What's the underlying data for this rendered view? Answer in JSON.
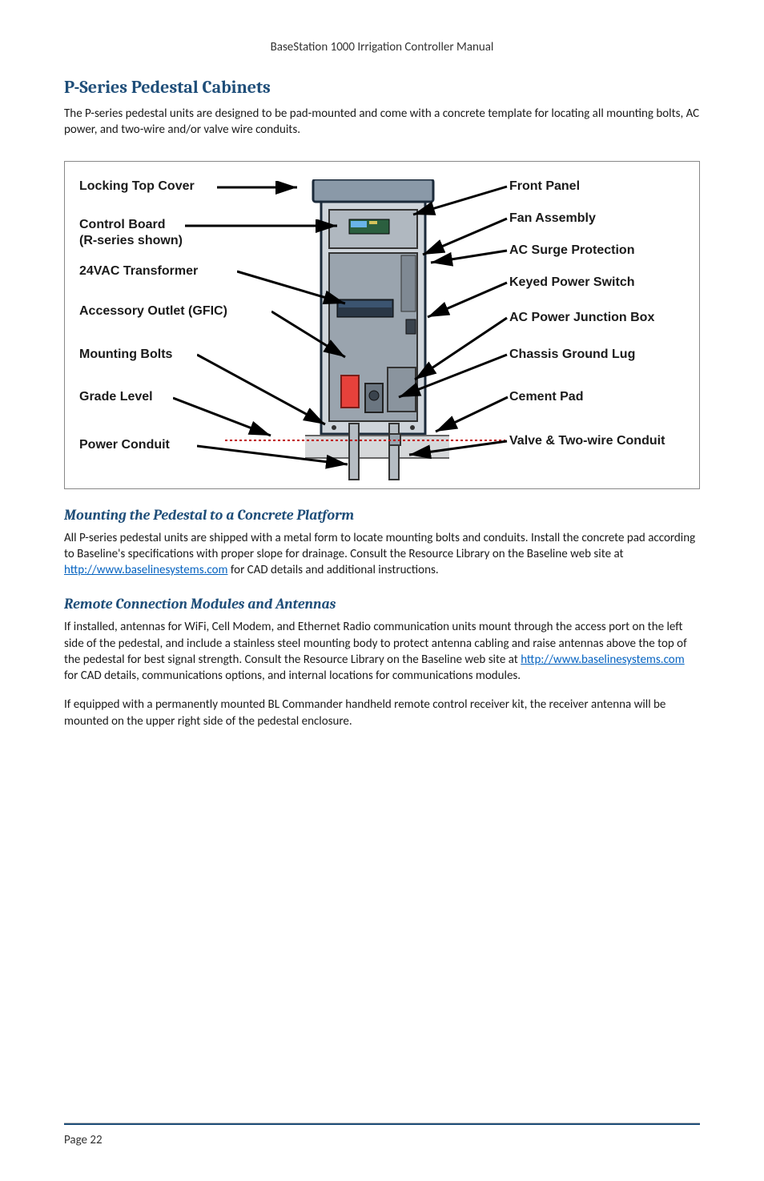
{
  "header": "BaseStation 1000 Irrigation Controller Manual",
  "section_title": "P-Series Pedestal Cabinets",
  "intro": "The P-series pedestal units are designed to be pad-mounted and come with a concrete template for locating all mounting bolts, AC power, and two-wire and/or valve wire conduits.",
  "diagram": {
    "left": {
      "locking_top": "Locking Top Cover",
      "control_board_l1": "Control Board",
      "control_board_l2": "(R-series shown)",
      "transformer": "24VAC Transformer",
      "outlet": "Accessory Outlet (GFIC)",
      "bolts": "Mounting Bolts",
      "grade": "Grade Level",
      "conduit": "Power Conduit"
    },
    "right": {
      "front_panel": "Front Panel",
      "fan": "Fan Assembly",
      "surge": "AC Surge Protection",
      "keyed": "Keyed Power Switch",
      "junction": "AC Power Junction Box",
      "ground": "Chassis Ground Lug",
      "cement": "Cement Pad",
      "valve_conduit": "Valve & Two-wire Conduit"
    }
  },
  "sub1_title": "Mounting the Pedestal to a Concrete Platform",
  "sub1_body_a": "All P-series pedestal units are shipped with a metal form to locate mounting bolts and conduits. Install the concrete pad according to Baseline's specifications with proper slope for drainage. Consult the Resource Library on the Baseline web site at ",
  "sub1_link": "http://www.baselinesystems.com",
  "sub1_body_b": " for CAD details and additional instructions.",
  "sub2_title": "Remote Connection Modules and Antennas",
  "sub2_p1_a": "If installed, antennas for WiFi, Cell Modem, and Ethernet Radio communication units mount through the access port on the left side of the pedestal, and include a stainless steel mounting body to protect antenna cabling and raise antennas above the top of the pedestal for best signal strength. Consult the Resource Library on the Baseline web site at ",
  "sub2_link": "http://www.baselinesystems.com",
  "sub2_p1_b": " for CAD details, communications options, and internal locations for communications modules.",
  "sub2_p2": "If equipped with a permanently mounted BL Commander handheld remote control receiver kit, the receiver antenna will be mounted on the upper right side of the pedestal enclosure.",
  "page": "Page 22"
}
